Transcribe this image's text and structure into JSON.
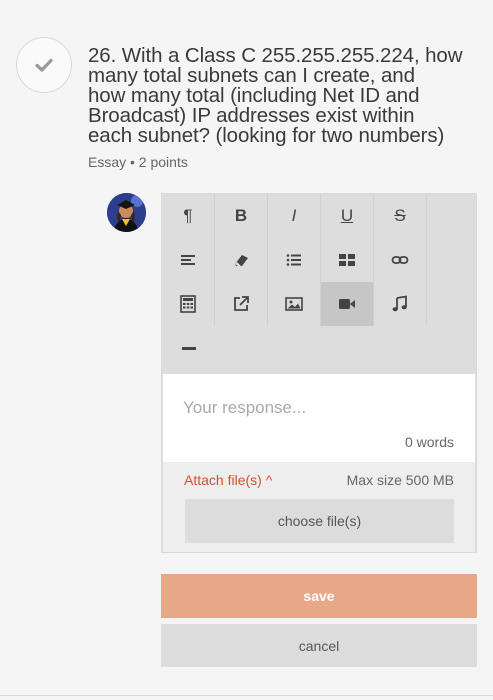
{
  "question": {
    "number": "26.",
    "lines": [
      "26. With a Class C 255.255.255.224, how",
      "many total subnets can I create, and",
      "how many total (including Net ID and",
      "Broadcast) IP addresses exist within",
      "each subnet? (looking for two numbers)"
    ],
    "meta": "Essay • 2 points",
    "status_icon": "checkmark-icon"
  },
  "toolbar": {
    "buttons": [
      {
        "name": "paragraph-icon",
        "glyph": "¶"
      },
      {
        "name": "bold-icon",
        "glyph": "B"
      },
      {
        "name": "italic-icon",
        "glyph": "I"
      },
      {
        "name": "underline-icon",
        "glyph": "U"
      },
      {
        "name": "strikethrough-icon",
        "glyph": "S"
      },
      {
        "name": "align-left-icon"
      },
      {
        "name": "eraser-icon"
      },
      {
        "name": "bullet-list-icon"
      },
      {
        "name": "table-icon"
      },
      {
        "name": "link-icon"
      },
      {
        "name": "calculator-icon"
      },
      {
        "name": "external-link-icon"
      },
      {
        "name": "image-icon"
      },
      {
        "name": "video-icon",
        "active": true
      },
      {
        "name": "music-icon"
      },
      {
        "name": "horizontal-rule-icon"
      }
    ]
  },
  "response": {
    "placeholder": "Your response...",
    "value": "",
    "word_count": "0 words"
  },
  "attachments": {
    "attach_label": "Attach file(s) ^",
    "max_size": "Max size 500 MB",
    "choose_label": "choose file(s)"
  },
  "actions": {
    "save_label": "save",
    "cancel_label": "cancel"
  },
  "colors": {
    "accent": "#d2532a",
    "save_bg": "#e8a787",
    "toolbar_bg": "#dddddd",
    "active_btn_bg": "#c6c6c6"
  }
}
